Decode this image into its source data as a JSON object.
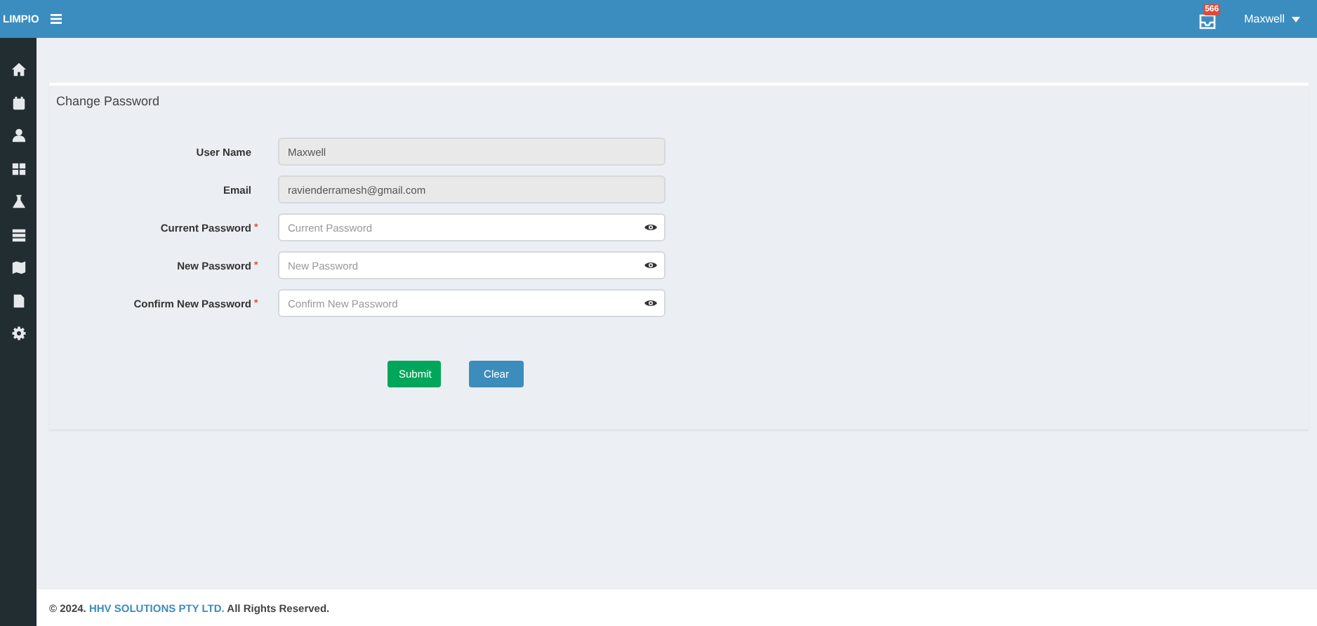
{
  "topbar": {
    "brand": "LIMPIO",
    "notification_count": "566",
    "user": "Maxwell"
  },
  "card": {
    "title": "Change Password",
    "fields": [
      {
        "label": "User Name",
        "kind": "readonly",
        "value": "Maxwell"
      },
      {
        "label": "Email",
        "kind": "readonly",
        "value": "ravienderramesh@gmail.com"
      },
      {
        "label": "Current Password",
        "kind": "password",
        "required_mark": "*",
        "placeholder": "Current Password"
      },
      {
        "label": "New Password",
        "kind": "password",
        "required_mark": "*",
        "placeholder": "New Password"
      },
      {
        "label": "Confirm New Password",
        "kind": "password",
        "required_mark": "*",
        "placeholder": "Confirm New Password"
      }
    ],
    "buttons": [
      {
        "label": "Submit",
        "kind": "primary"
      },
      {
        "label": "Clear",
        "kind": "secondary"
      }
    ]
  },
  "footer": {
    "prefix": "© 2024.",
    "link": "HHV SOLUTIONS PTY LTD.",
    "suffix": "All Rights Reserved."
  }
}
